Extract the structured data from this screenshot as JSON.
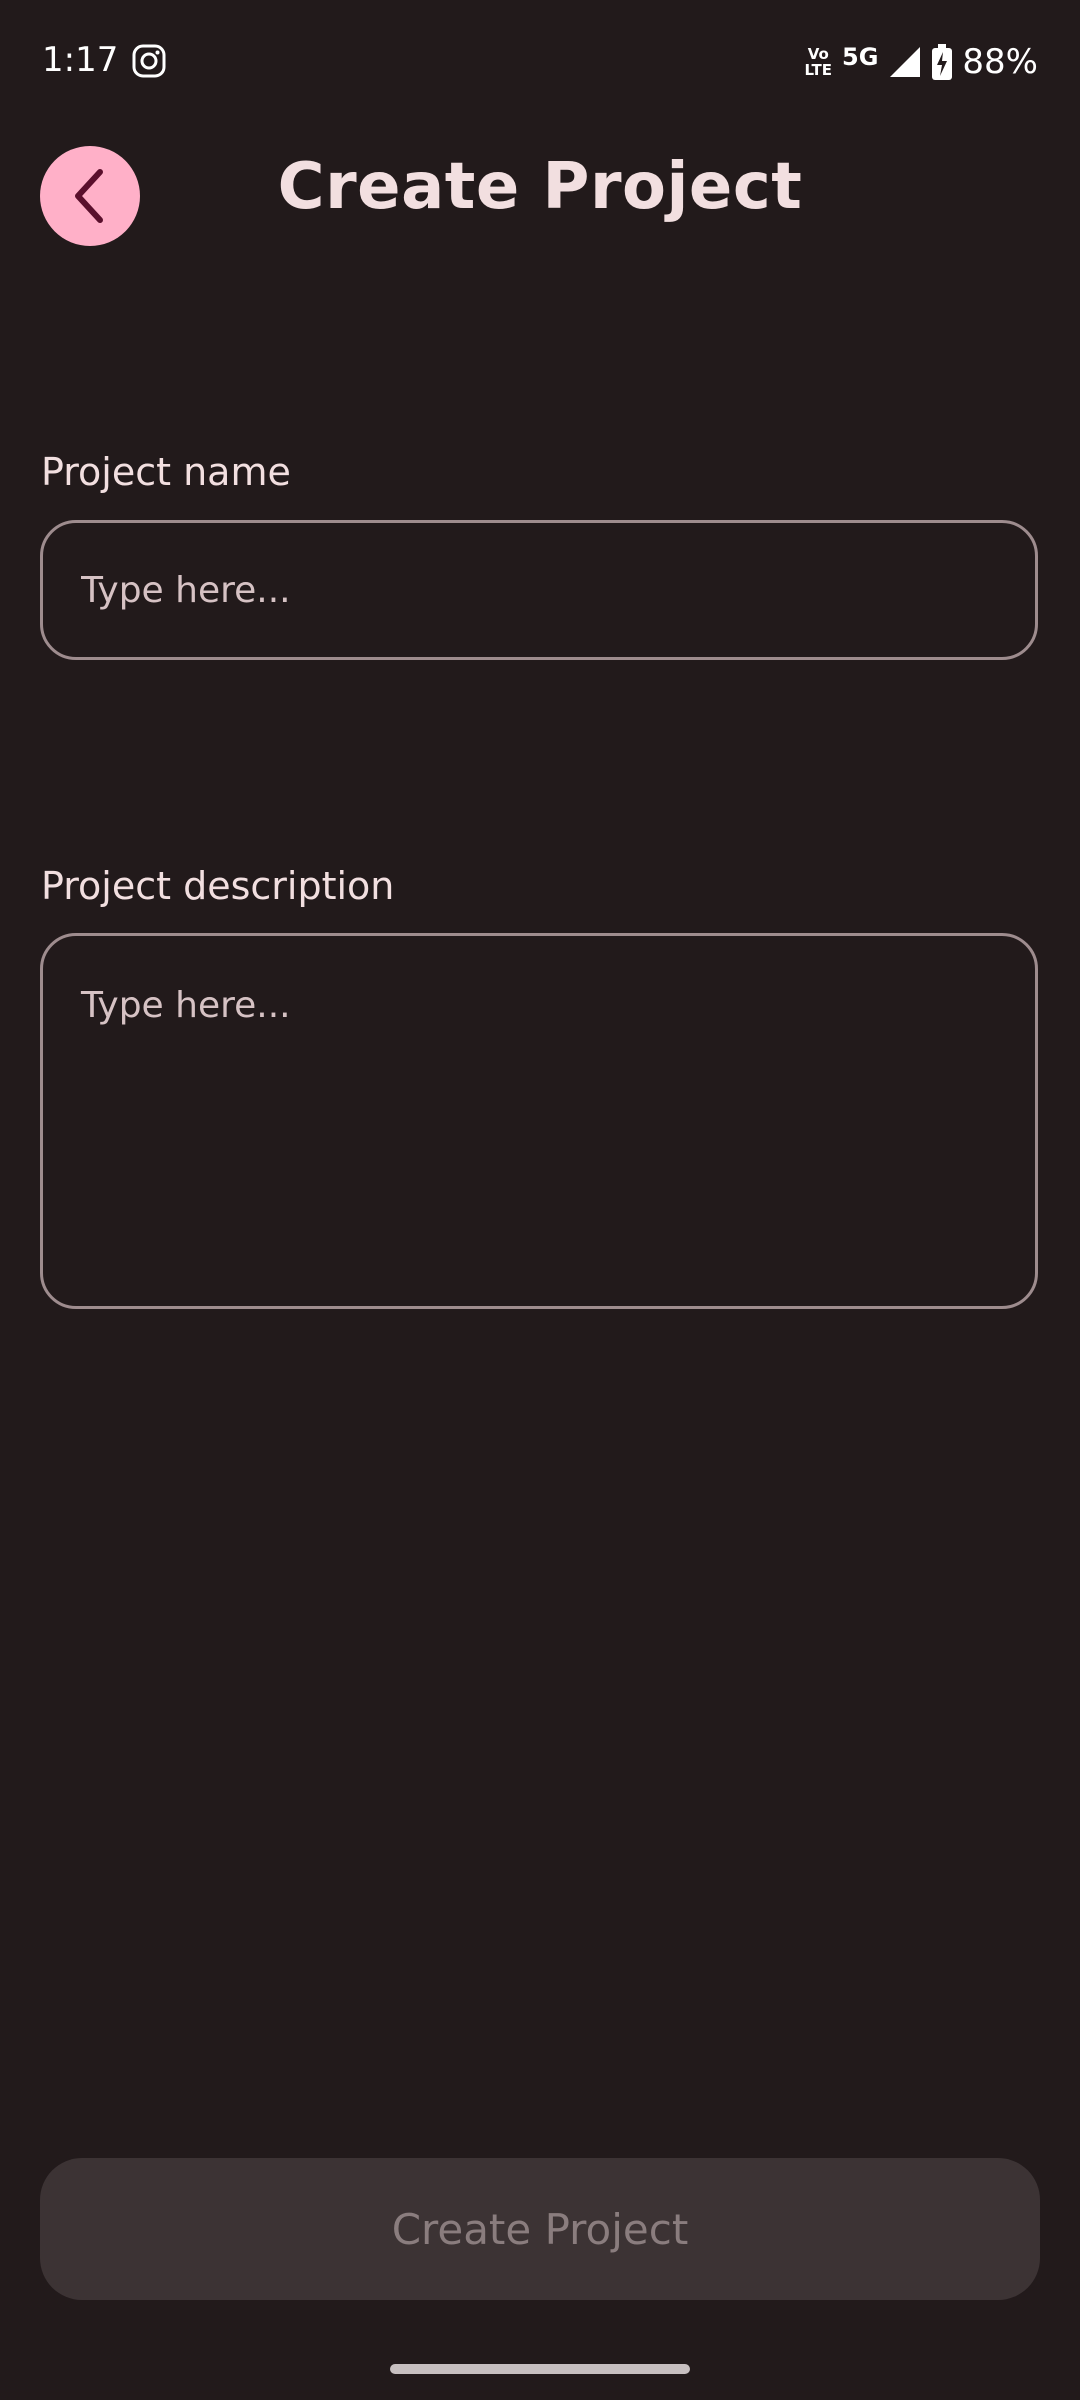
{
  "status_bar": {
    "time": "1:17",
    "volte_top": "Vo",
    "volte_bottom": "LTE",
    "network": "5G",
    "battery_percent": "88%",
    "icons": [
      "instagram-icon",
      "wifi-calling-icon",
      "signal-icon",
      "battery-charging-icon"
    ]
  },
  "header": {
    "title": "Create Project",
    "back_icon": "chevron-left-icon"
  },
  "form": {
    "name_label": "Project name",
    "name_placeholder": "Type here...",
    "name_value": "",
    "description_label": "Project description",
    "description_placeholder": "Type here...",
    "description_value": ""
  },
  "actions": {
    "create_label": "Create Project"
  },
  "colors": {
    "background": "#221a1b",
    "accent": "#ffb0c8",
    "button_disabled_bg": "#3c3334",
    "button_disabled_text": "#8a7d7e",
    "field_border": "#9e8c8e",
    "text": "#f2dfe0"
  }
}
